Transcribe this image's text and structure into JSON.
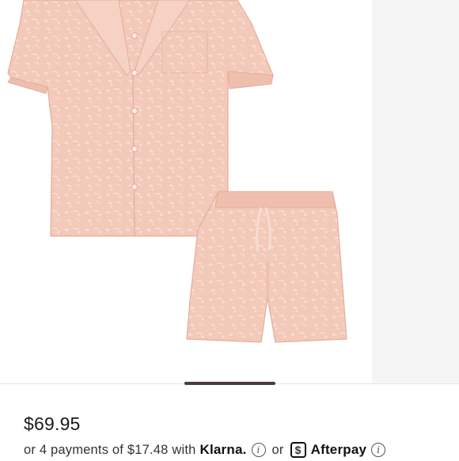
{
  "product": {
    "image_alt": "Pink leopard print short-sleeve pajama shirt and shorts set",
    "price": "$69.95"
  },
  "payments": {
    "prefix": "or 4 payments of $17.48 with",
    "klarna": "Klarna.",
    "or": "or",
    "afterpay": "Afterpay",
    "info_glyph": "i",
    "afterpay_glyph": "$"
  },
  "colors": {
    "fabric": "#f1c4b4",
    "accent_indicator": "#4a3b40"
  },
  "icons": [
    "info-icon",
    "afterpay-icon"
  ]
}
